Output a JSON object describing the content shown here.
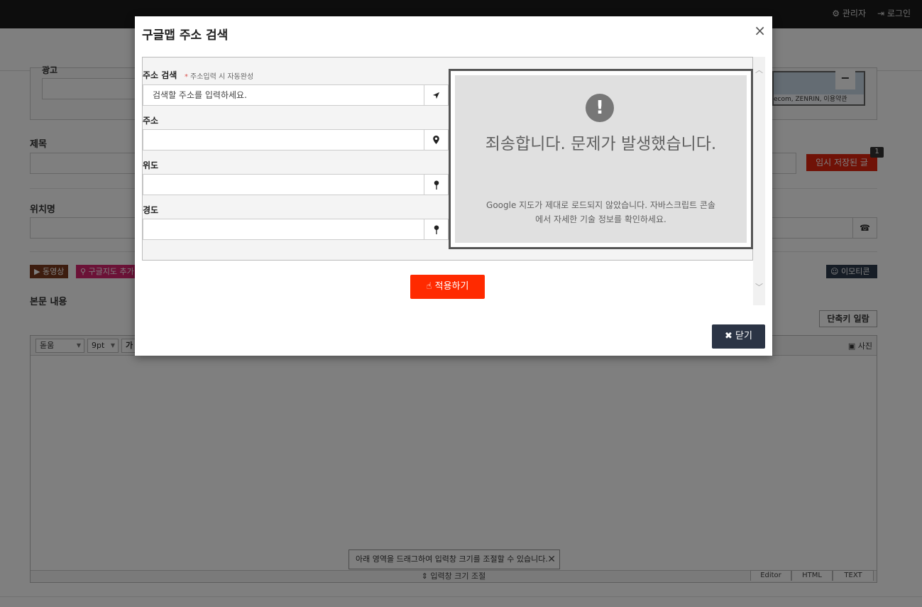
{
  "topbar": {
    "admin_label": "⚙ 관리자",
    "login_label": "⇥ 로그인"
  },
  "form": {
    "hidden_label": "광고",
    "title_label": "제목",
    "location_label": "위치명",
    "content_label": "본문 내용",
    "temp_saved_label": "임시 저장된 글",
    "temp_saved_count": "1",
    "video_tag": "▶ 동영상",
    "map_tag": "⚲ 구글지도 추가",
    "emoticon_label": "☺ 이모티콘",
    "shortcut_label": "단축키 일람",
    "phone_icon": "☎"
  },
  "editor": {
    "font_select": "돋움",
    "size_select": "9pt",
    "bold_label": "가",
    "photo_label": "사진",
    "tooltip_text": "아래 영역을 드래그하여 입력창 크기를 조절할 수 있습니다.",
    "resize_label": "⇕ 입력창 크기 조절",
    "tabs": [
      "Editor",
      "HTML",
      "TEXT"
    ]
  },
  "modal": {
    "title": "구글맵 주소 검색",
    "close_symbol": "×",
    "search_label": "주소 검색",
    "search_hint": "주소입력 시 자동완성",
    "search_placeholder": "검색할 주소를 입력하세요.",
    "address_label": "주소",
    "lat_label": "위도",
    "lng_label": "경도",
    "address_value": "",
    "lat_value": "",
    "lng_value": "",
    "map_error_title": "죄송합니다. 문제가 발생했습니다.",
    "map_error_message": "Google 지도가 제대로 로드되지 않았습니다. 자바스크립트 콘솔에서 자세한 기술 정보를 확인하세요.",
    "map_error_symbol": "!",
    "map_attribution": "ecom, ZENRIN, 이용약관",
    "apply_label": "적용하기",
    "close_label": "✖ 닫기"
  },
  "colors": {
    "accent_red": "#ff2a00",
    "dark_button": "#2b3445",
    "topbar": "#1b1b1b"
  }
}
